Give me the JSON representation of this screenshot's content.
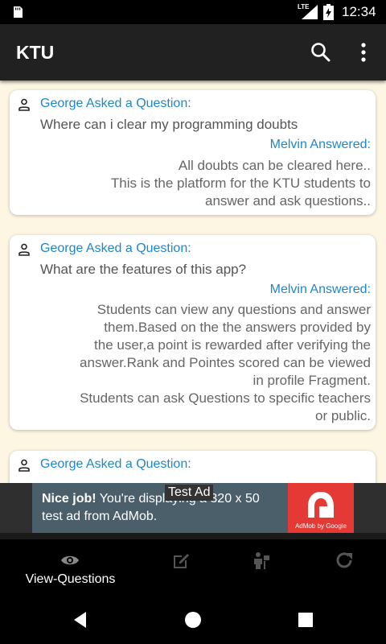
{
  "status_bar": {
    "network": "LTE",
    "time": "12:34"
  },
  "app_bar": {
    "title": "KTU",
    "icons": [
      "search-icon",
      "more-vert-icon"
    ]
  },
  "cards": [
    {
      "asker": "George Asked a Question:",
      "question": "Where can i clear my programming doubts",
      "answerer": "Melvin Answered:",
      "answer_lines": [
        "All doubts can be cleared here..",
        "This is the platform for the KTU students to",
        "answer and ask questions.."
      ]
    },
    {
      "asker": "George Asked a Question:",
      "question": "What are the features of this app?",
      "answerer": "Melvin Answered:",
      "answer_lines": [
        "Students can view any questions and answer",
        "them.Based on the the answers provided by",
        "the user,a point is rewarded after verifying the",
        "answer.Rank and Pointes scored can be viewed",
        "in profile Fragment.",
        "Students can ask Questions to specific teachers",
        "or public."
      ]
    },
    {
      "asker": "George Asked a Question:"
    }
  ],
  "ad": {
    "bold": "Nice job!",
    "text": " You're displaying a 320 x 50 test ad from AdMob.",
    "label": "Test Ad",
    "logo_caption": "AdMob by Google",
    "logo_color": "#e53935"
  },
  "bottom_nav": {
    "items": [
      {
        "label": "View-Questions",
        "icon": "eye-icon",
        "active": true
      },
      {
        "label": "",
        "icon": "edit-icon",
        "active": false
      },
      {
        "label": "",
        "icon": "leaderboard-icon",
        "active": false
      },
      {
        "label": "",
        "icon": "refresh-icon",
        "active": false
      }
    ]
  },
  "colors": {
    "accent": "#1e88c8",
    "app_bar": "#212121",
    "background": "#fdf6e3"
  }
}
